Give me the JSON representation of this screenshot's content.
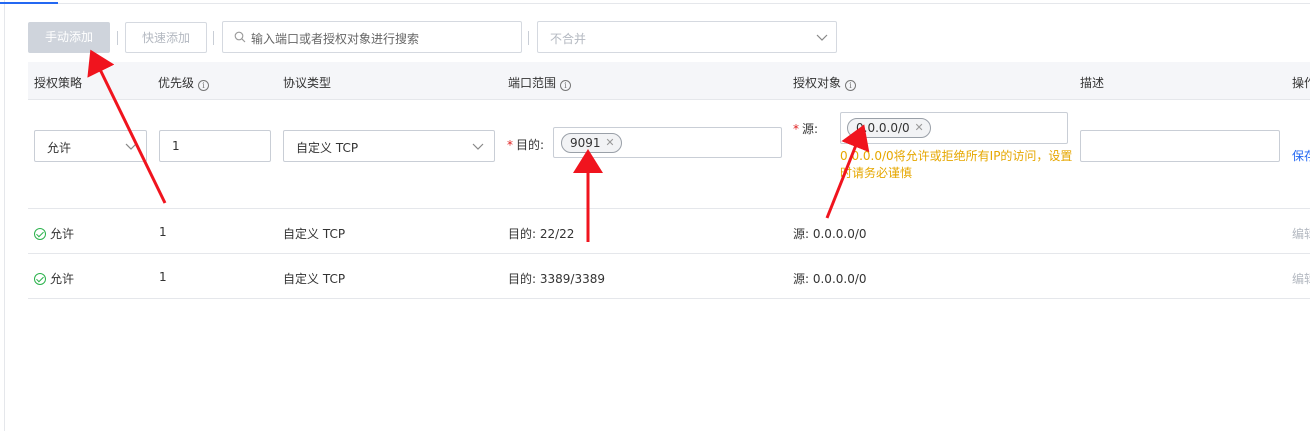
{
  "toolbar": {
    "manual_add": "手动添加",
    "quick_add": "快速添加",
    "search_placeholder": "输入端口或者授权对象进行搜索",
    "merge_select": "不合并"
  },
  "table": {
    "headers": {
      "policy": "授权策略",
      "priority": "优先级",
      "protocol": "协议类型",
      "port_range": "端口范围",
      "auth_object": "授权对象",
      "description": "描述",
      "actions": "操作"
    },
    "info_glyph": "i",
    "edit_row": {
      "policy": "允许",
      "priority": "1",
      "protocol": "自定义 TCP",
      "dest_label": "目的:",
      "port_tag": "9091",
      "source_label": "源:",
      "source_tag": "0.0.0.0/0",
      "warning": "0.0.0.0/0将允许或拒绝所有IP的访问，设置时请务必谨慎",
      "description": "",
      "save": "保存"
    },
    "rows": [
      {
        "policy": "允许",
        "priority": "1",
        "protocol": "自定义 TCP",
        "port": "目的: 22/22",
        "source": "源: 0.0.0.0/0",
        "action": "编辑"
      },
      {
        "policy": "允许",
        "priority": "1",
        "protocol": "自定义 TCP",
        "port": "目的: 3389/3389",
        "source": "源: 0.0.0.0/0",
        "action": "编辑"
      }
    ]
  },
  "colors": {
    "accent": "#2468f2",
    "annotation_arrow": "#f0141e",
    "warning": "#e6a700",
    "success": "#2bb24c"
  }
}
